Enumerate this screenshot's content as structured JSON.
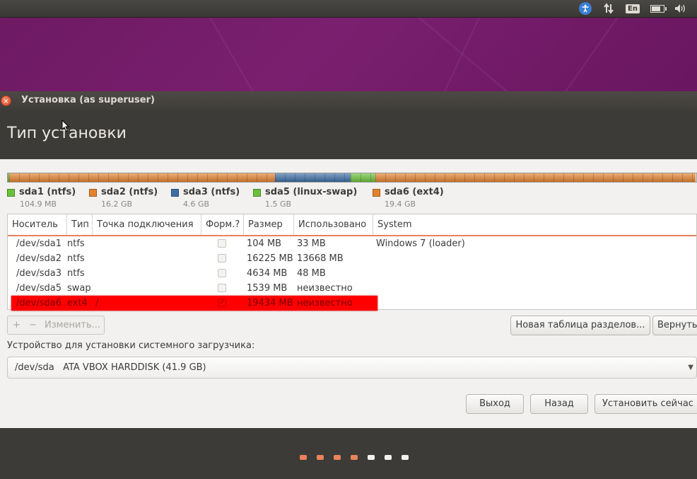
{
  "tray": {
    "accessibility_icon": "accessibility-icon",
    "network_icon": "network-arrows-icon",
    "lang_label": "En",
    "battery_icon": "battery-icon",
    "volume_icon": "volume-icon"
  },
  "window": {
    "title": "Установка (as superuser)",
    "close_glyph": "×"
  },
  "page": {
    "title": "Тип установки"
  },
  "colors": {
    "ntfs_orange": "#e3832f",
    "ntfs_blue": "#3f6ea5",
    "swap_green": "#6cc13a",
    "ext4_orange": "#e3832f",
    "legend_green": "#6cc13a",
    "selection": "#ff0000",
    "accent": "#e9835a"
  },
  "partition_bar": {
    "fractions": [
      0.0025,
      0.386,
      0.11,
      0.036,
      0.4655
    ],
    "colors": [
      "#6cc13a",
      "#e3832f",
      "#3f6ea5",
      "#6cc13a",
      "#e3832f"
    ]
  },
  "legend": [
    {
      "name": "sda1 (ntfs)",
      "size": "104.9 MB",
      "color": "#6cc13a"
    },
    {
      "name": "sda2 (ntfs)",
      "size": "16.2 GB",
      "color": "#e3832f"
    },
    {
      "name": "sda3 (ntfs)",
      "size": "4.6 GB",
      "color": "#3f6ea5"
    },
    {
      "name": "sda5 (linux-swap)",
      "size": "1.5 GB",
      "color": "#6cc13a"
    },
    {
      "name": "sda6 (ext4)",
      "size": "19.4 GB",
      "color": "#e3832f"
    }
  ],
  "table": {
    "headers": [
      "Носитель",
      "Тип",
      "Точка подключения",
      "Форм.?",
      "Размер",
      "Использовано",
      "System"
    ],
    "rows": [
      {
        "device": "/dev/sda1",
        "type": "ntfs",
        "mount": "",
        "format": false,
        "size": "104 MB",
        "used": "33 MB",
        "system": "Windows 7 (loader)",
        "selected": false
      },
      {
        "device": "/dev/sda2",
        "type": "ntfs",
        "mount": "",
        "format": false,
        "size": "16225 MB",
        "used": "13668 MB",
        "system": "",
        "selected": false
      },
      {
        "device": "/dev/sda3",
        "type": "ntfs",
        "mount": "",
        "format": false,
        "size": "4634 MB",
        "used": "48 MB",
        "system": "",
        "selected": false
      },
      {
        "device": "/dev/sda5",
        "type": "swap",
        "mount": "",
        "format": false,
        "size": "1539 MB",
        "used": "неизвестно",
        "system": "",
        "selected": false
      },
      {
        "device": "/dev/sda6",
        "type": "ext4",
        "mount": "/",
        "format": true,
        "size": "19434 MB",
        "used": "неизвестно",
        "system": "",
        "selected": true
      }
    ]
  },
  "toolbar": {
    "add": "+",
    "remove": "−",
    "change": "Изменить..."
  },
  "buttons": {
    "new_table": "Новая таблица разделов...",
    "revert": "Вернуть",
    "quit": "Выход",
    "back": "Назад",
    "install": "Установить сейчас"
  },
  "bootloader": {
    "label": "Устройство для установки системного загрузчика:",
    "value": "/dev/sda   ATA VBOX HARDDISK (41.9 GB)",
    "arrow": "▼"
  },
  "progress": {
    "steps_total": 7,
    "steps_done": 4,
    "done_color": "#e9835a",
    "todo_color": "#f2f1f0"
  }
}
